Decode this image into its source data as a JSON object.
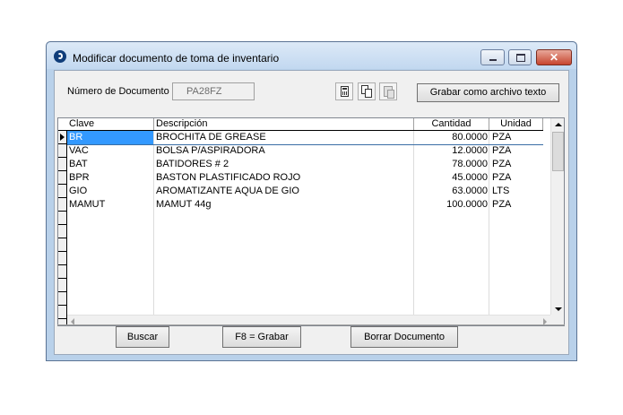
{
  "window": {
    "title": "Modificar documento de toma de inventario"
  },
  "header": {
    "doc_label": "Número de Documento",
    "doc_value": "PA28FZ",
    "save_text_button": "Grabar como archivo texto"
  },
  "grid": {
    "columns": [
      "Clave",
      "Descripción",
      "Cantidad",
      "Unidad"
    ],
    "rows": [
      {
        "clave": "BR",
        "descripcion": "BROCHITA DE GREASE",
        "cantidad": "80.0000",
        "unidad": "PZA"
      },
      {
        "clave": "VAC",
        "descripcion": "BOLSA P/ASPIRADORA",
        "cantidad": "12.0000",
        "unidad": "PZA"
      },
      {
        "clave": "BAT",
        "descripcion": "BATIDORES # 2",
        "cantidad": "78.0000",
        "unidad": "PZA"
      },
      {
        "clave": "BPR",
        "descripcion": "BASTON PLASTIFICADO ROJO",
        "cantidad": "45.0000",
        "unidad": "PZA"
      },
      {
        "clave": "GIO",
        "descripcion": "AROMATIZANTE AQUA DE GIO",
        "cantidad": "63.0000",
        "unidad": "LTS"
      },
      {
        "clave": "MAMUT",
        "descripcion": "MAMUT 44g",
        "cantidad": "100.0000",
        "unidad": "PZA"
      }
    ]
  },
  "footer": {
    "buscar": "Buscar",
    "grabar": "F8 = Grabar",
    "borrar": "Borrar Documento"
  }
}
